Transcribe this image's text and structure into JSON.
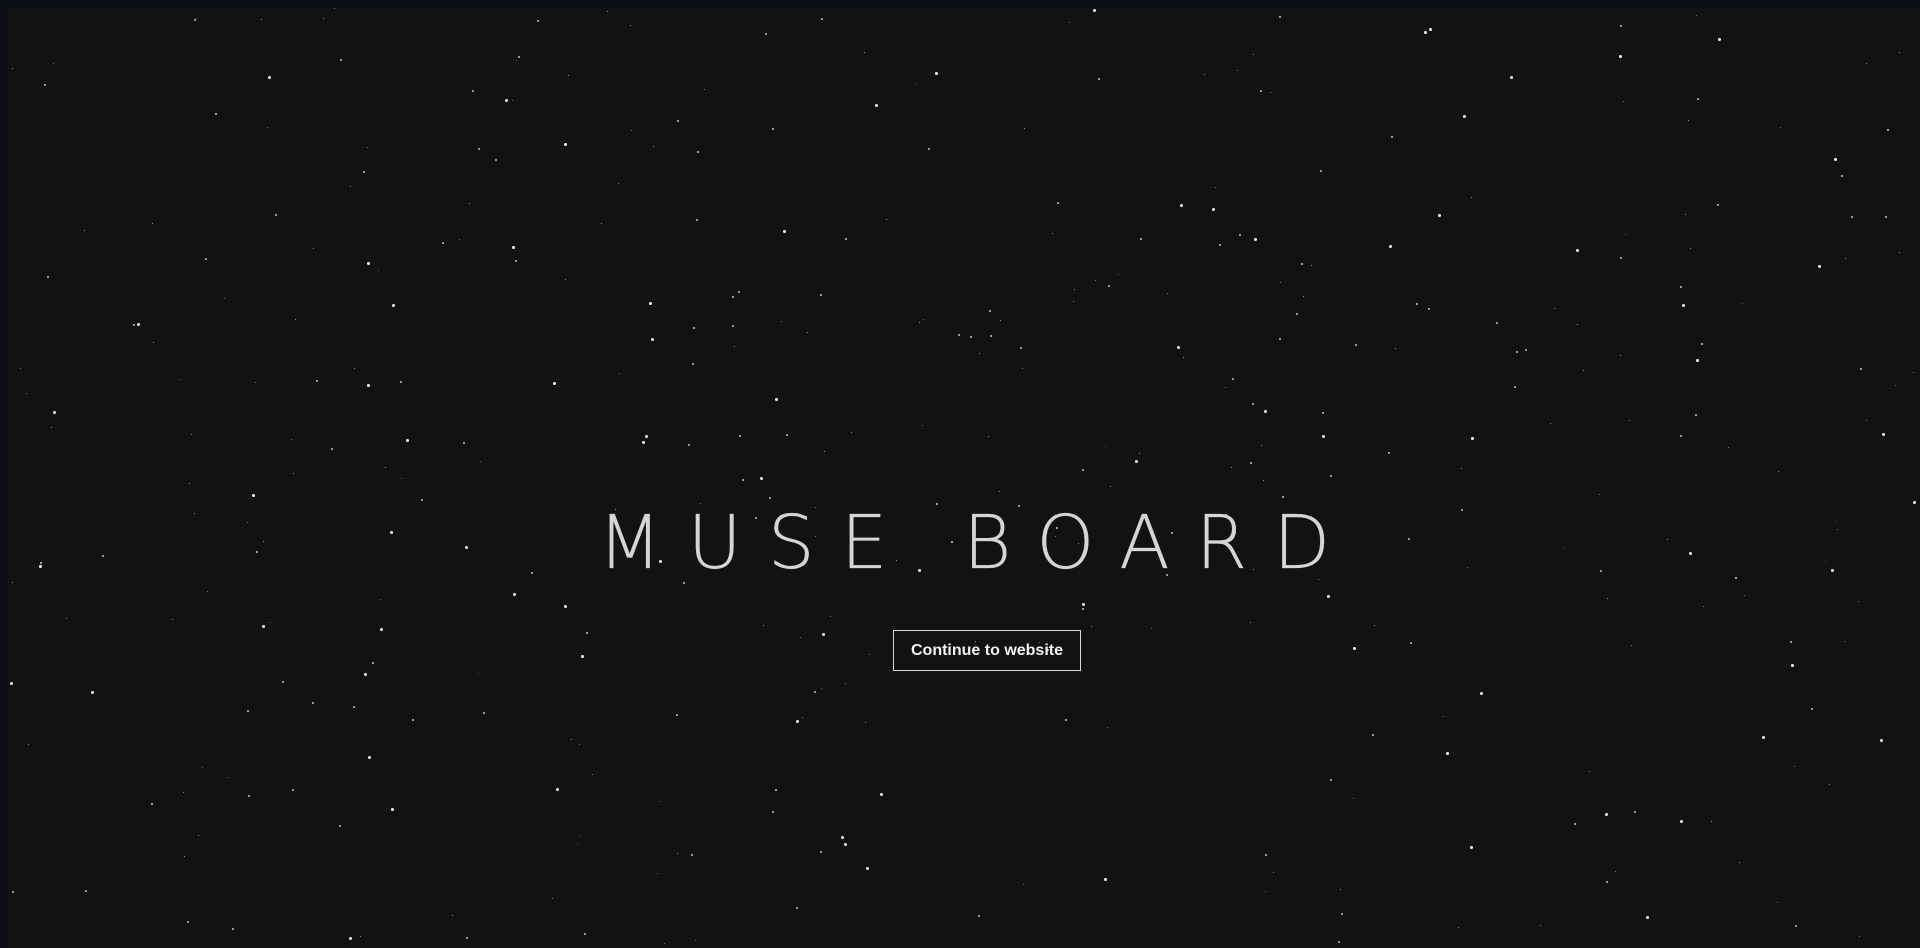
{
  "hero": {
    "title": "MUSE BOARD",
    "cta_label": "Continue to website"
  },
  "theme": {
    "page_background": "#121212",
    "frame_background": "#0c0f17",
    "text_color": "#e6e6e6",
    "star_color": "#ffffff"
  }
}
